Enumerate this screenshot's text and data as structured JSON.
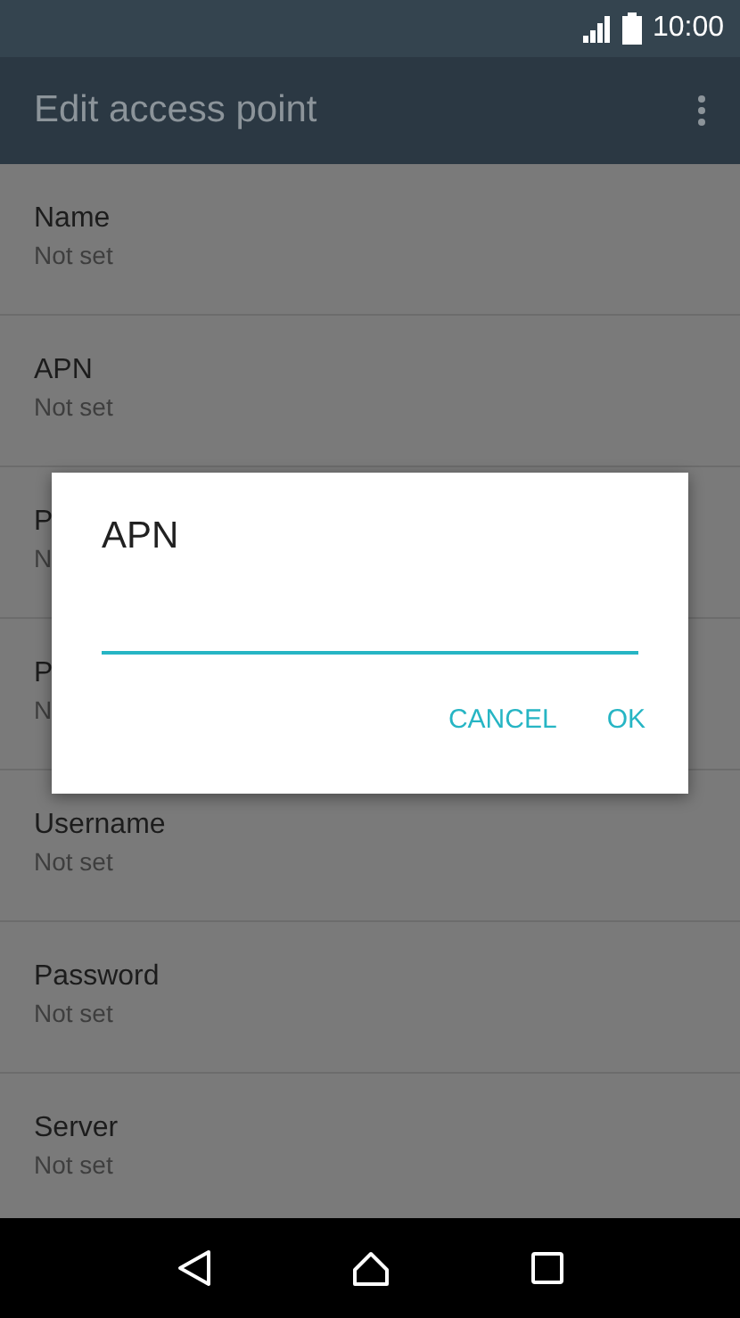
{
  "status_bar": {
    "time": "10:00"
  },
  "toolbar": {
    "title": "Edit access point"
  },
  "settings": [
    {
      "title": "Name",
      "summary": "Not set"
    },
    {
      "title": "APN",
      "summary": "Not set"
    },
    {
      "title": "P",
      "summary": "N"
    },
    {
      "title": "P",
      "summary": "N"
    },
    {
      "title": "Username",
      "summary": "Not set"
    },
    {
      "title": "Password",
      "summary": "Not set"
    },
    {
      "title": "Server",
      "summary": "Not set"
    }
  ],
  "dialog": {
    "title": "APN",
    "buttons": [
      "CANCEL",
      "OK"
    ]
  }
}
